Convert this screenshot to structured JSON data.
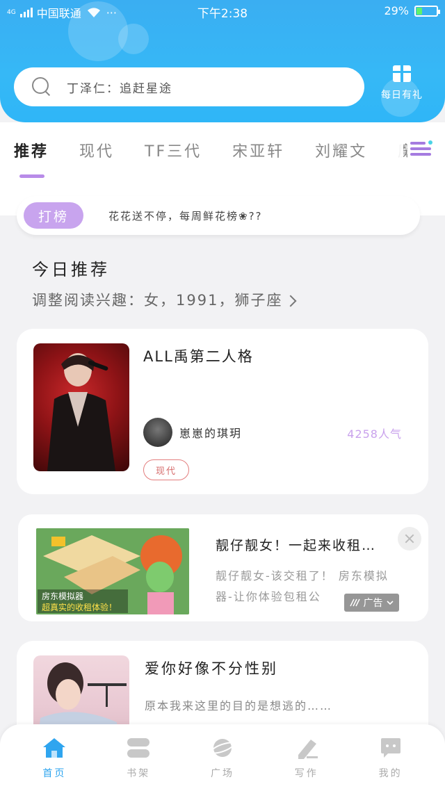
{
  "status_bar": {
    "network": "4G",
    "carrier": "中国联通",
    "dots": "···",
    "time": "下午2:38",
    "battery_percent": "29%",
    "battery_level": 0.29
  },
  "search": {
    "placeholder": "丁泽仁：追赶星途"
  },
  "daily_gift": {
    "label": "每日有礼"
  },
  "tabs": [
    "推荐",
    "现代",
    "TF三代",
    "宋亚轩",
    "刘耀文",
    "魔"
  ],
  "notice": {
    "badge": "打榜",
    "text": "花花送不停，每周鲜花榜❀??"
  },
  "recommend": {
    "title": "今日推荐",
    "subtitle": "调整阅读兴趣：女，1991，狮子座"
  },
  "book1": {
    "title": "ALL禹第二人格",
    "author": "崽崽的琪玥",
    "popularity": "4258人气",
    "tag": "现代"
  },
  "ad": {
    "title": "靓仔靓女！一起来收租…",
    "desc": "靓仔靓女-该交租了！ 房东模拟器-让你体验包租公",
    "badge": "广告",
    "image_caption_1": "房东模拟器",
    "image_caption_2": "超真实的收租体验！"
  },
  "book3": {
    "title": "爱你好像不分性别",
    "desc": "原本我来这里的目的是想逃的……"
  },
  "bottom_nav": [
    {
      "label": "首页",
      "icon": "home-icon",
      "active": true
    },
    {
      "label": "书架",
      "icon": "bookshelf-icon",
      "active": false
    },
    {
      "label": "广场",
      "icon": "planet-icon",
      "active": false
    },
    {
      "label": "写作",
      "icon": "pen-icon",
      "active": false
    },
    {
      "label": "我的",
      "icon": "chat-bubble-icon",
      "active": false
    }
  ],
  "colors": {
    "header_blue": "#36b8f6",
    "accent_purple": "#b88be8",
    "nav_active": "#2fa5ef",
    "tag_red": "#d66c6c"
  }
}
